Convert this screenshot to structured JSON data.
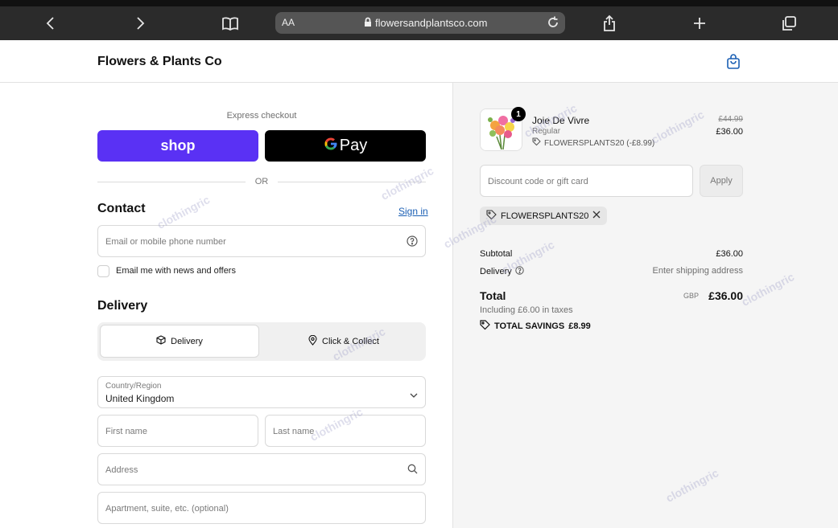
{
  "browser": {
    "aa_label": "AA",
    "url": "flowersandplantsco.com"
  },
  "header": {
    "store_name": "Flowers & Plants Co"
  },
  "express": {
    "title": "Express checkout",
    "shop_label": "shop",
    "gpay_label": "Pay",
    "or_label": "OR"
  },
  "contact": {
    "title": "Contact",
    "signin_label": "Sign in",
    "email_placeholder": "Email or mobile phone number",
    "newsletter_label": "Email me with news and offers"
  },
  "delivery": {
    "title": "Delivery",
    "option_delivery": "Delivery",
    "option_collect": "Click & Collect",
    "country_label": "Country/Region",
    "country_value": "United Kingdom",
    "first_name_placeholder": "First name",
    "last_name_placeholder": "Last name",
    "address_placeholder": "Address",
    "apartment_placeholder": "Apartment, suite, etc. (optional)"
  },
  "order": {
    "quantity": "1",
    "product_name": "Joie De Vivre",
    "product_variant": "Regular",
    "product_discount": "FLOWERSPLANTS20 (-£8.99)",
    "price_old": "£44.99",
    "price_new": "£36.00",
    "discount_placeholder": "Discount code or gift card",
    "apply_label": "Apply",
    "applied_code": "FLOWERSPLANTS20",
    "subtotal_label": "Subtotal",
    "subtotal_value": "£36.00",
    "delivery_label": "Delivery",
    "delivery_value": "Enter shipping address",
    "total_label": "Total",
    "total_currency": "GBP",
    "total_value": "£36.00",
    "taxes_note": "Including £6.00 in taxes",
    "savings_label": "TOTAL SAVINGS",
    "savings_value": "£8.99"
  },
  "watermark": "clothingric",
  "colors": {
    "shop_purple": "#5a31f4",
    "link_blue": "#1a5fb4",
    "cart_blue": "#1a5fb4"
  }
}
